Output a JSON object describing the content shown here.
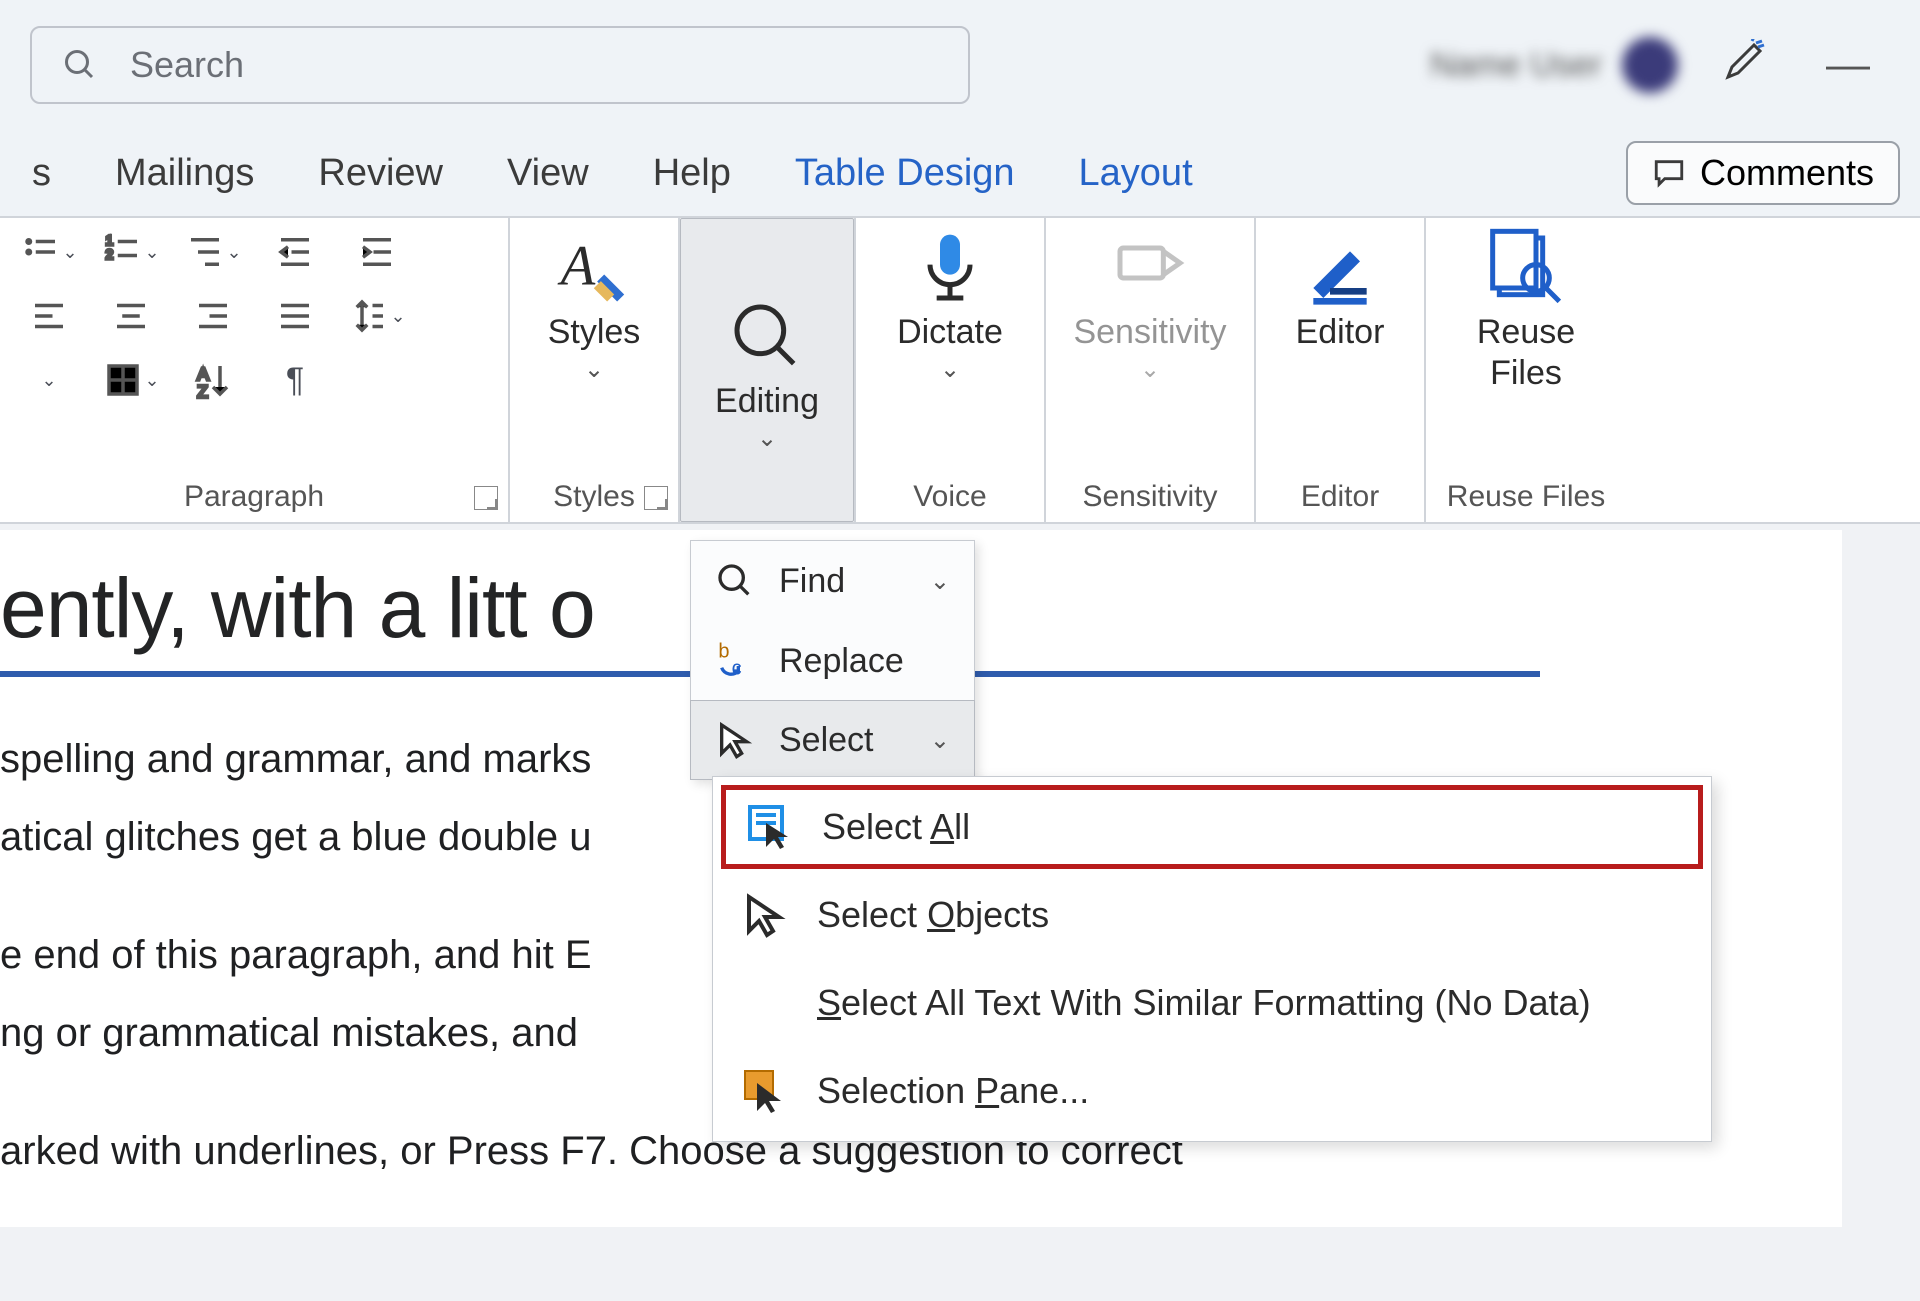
{
  "titlebar": {
    "search_placeholder": "Search",
    "user_name": "Name User"
  },
  "tabs": {
    "items": [
      "s",
      "Mailings",
      "Review",
      "View",
      "Help",
      "Table Design",
      "Layout"
    ],
    "active_index": 5,
    "comments_label": "Comments"
  },
  "ribbon": {
    "paragraph_label": "Paragraph",
    "styles": {
      "label": "Styles",
      "button": "Styles"
    },
    "editing": {
      "button": "Editing"
    },
    "voice": {
      "label": "Voice",
      "button": "Dictate"
    },
    "sensitivity": {
      "label": "Sensitivity",
      "button": "Sensitivity"
    },
    "editor": {
      "label": "Editor",
      "button": "Editor"
    },
    "reuse": {
      "label": "Reuse Files",
      "button": "Reuse\nFiles"
    }
  },
  "editing_dropdown": {
    "find": "Find",
    "replace": "Replace",
    "select": "Select"
  },
  "select_menu": {
    "select_all_pre": "Select ",
    "select_all_u": "A",
    "select_all_post": "ll",
    "select_objects_pre": "Select ",
    "select_objects_u": "O",
    "select_objects_post": "bjects",
    "similar_pre": "",
    "similar_u": "S",
    "similar_post": "elect All Text With Similar Formatting (No Data)",
    "pane_pre": "Selection ",
    "pane_u": "P",
    "pane_post": "ane..."
  },
  "document": {
    "heading": "ently, with a litt       o",
    "p1": "spelling and grammar, and marks",
    "p2": "atical glitches get a blue double u",
    "p3": "e end of this paragraph, and hit E",
    "p4": "ng or grammatical mistakes, and",
    "p5": "arked with underlines, or Press F7. Choose a suggestion to correct"
  }
}
